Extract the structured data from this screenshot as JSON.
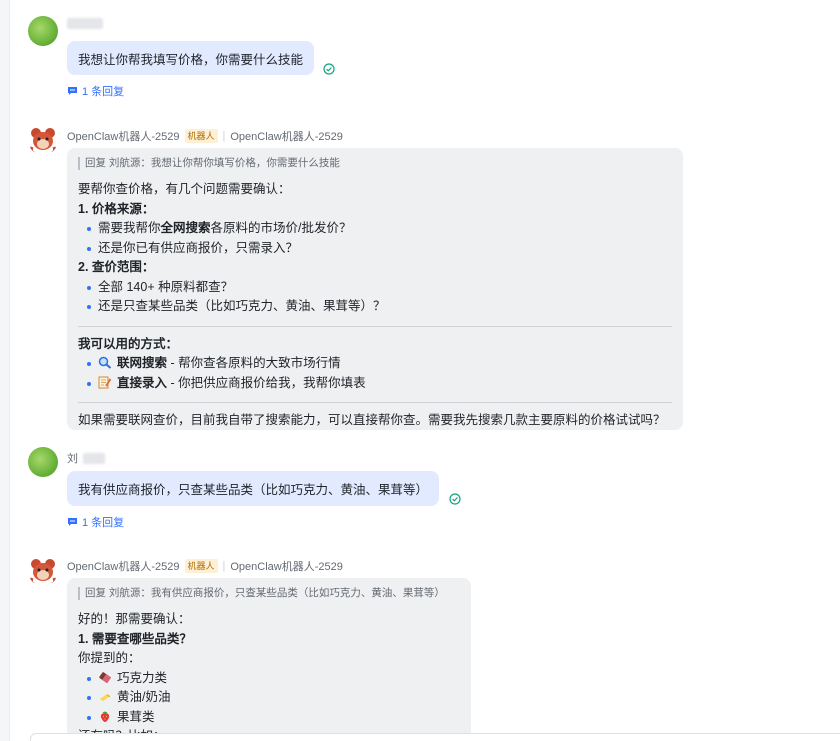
{
  "messages": {
    "m1": {
      "text": "我想让你帮我填写价格，你需要什么技能",
      "reply_count": "1 条回复"
    },
    "m2": {
      "sender": "OpenClaw机器人-2529",
      "tag": "机器人",
      "sender2": "OpenClaw机器人-2529",
      "quote": "回复 刘航源：我想让你帮你填写价格，你需要什么技能",
      "intro": "要帮你查价格，有几个问题需要确认：",
      "q1_title": "1. 价格来源：",
      "q1_b1_pre": "需要我帮你",
      "q1_b1_bold": "全网搜索",
      "q1_b1_post": "各原料的市场价/批发价？",
      "q1_b2": "还是你已有供应商报价，只需录入？",
      "q2_title": "2. 查价范围：",
      "q2_b1": "全部 140+ 种原料都查？",
      "q2_b2": "还是只查某些品类（比如巧克力、黄油、果茸等）？",
      "ways_title": "我可以用的方式：",
      "w1_bold": "联网搜索",
      "w1_rest": " - 帮你查各原料的大致市场行情",
      "w2_bold": "直接录入",
      "w2_rest": " - 你把供应商报价给我，我帮你填表",
      "closing": "如果需要联网查价，目前我自带了搜索能力，可以直接帮你查。需要我先搜索几款主要原料的价格试试吗？"
    },
    "m3": {
      "sender_visible": "刘",
      "text": "我有供应商报价，只查某些品类（比如巧克力、黄油、果茸等）",
      "reply_count": "1 条回复"
    },
    "m4": {
      "sender": "OpenClaw机器人-2529",
      "tag": "机器人",
      "sender2": "OpenClaw机器人-2529",
      "quote": "回复 刘航源：我有供应商报价，只查某些品类（比如巧克力、黄油、果茸等）",
      "l1": "好的！那需要确认：",
      "l2": "1. 需要查哪些品类？",
      "l3": "你提到的：",
      "b1": "巧克力类",
      "b2": "黄油/奶油",
      "b3": "果茸类",
      "l4": "还有吗？比如："
    }
  },
  "icons": {
    "read": "check-circle-icon",
    "reply": "comment-icon",
    "search": "magnifier-icon",
    "memo": "memo-icon",
    "chocolate": "chocolate-icon",
    "butter": "butter-icon",
    "strawberry": "strawberry-icon"
  },
  "colors": {
    "user_bubble": "#e1eaff",
    "bot_card": "#eff0f1",
    "link": "#3370ff",
    "read_check": "#14a37f",
    "bot_tag_bg": "#fdf0d5"
  }
}
